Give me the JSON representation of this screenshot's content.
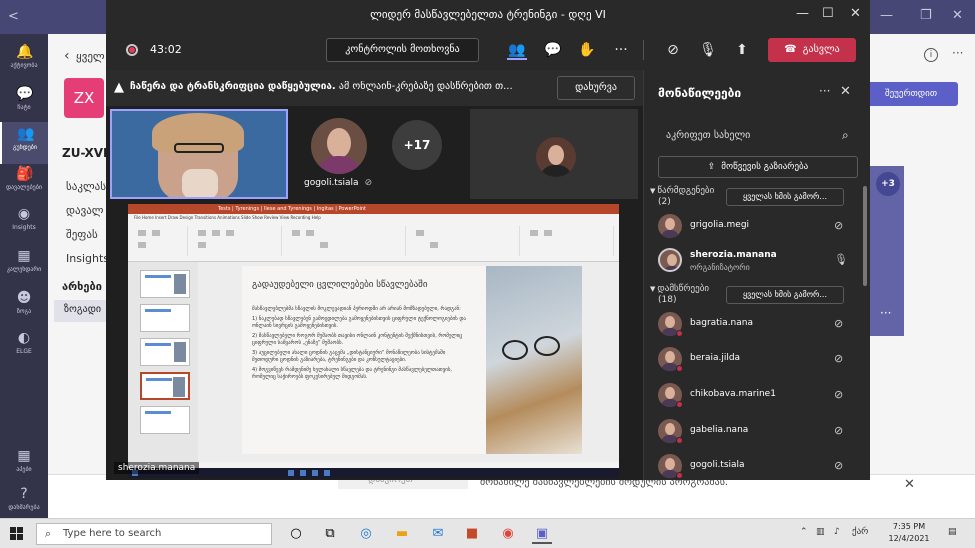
{
  "meeting": {
    "title": "ლიდერ მასწავლებელთა ტრენინგი - დღე VI",
    "timer": "43:02",
    "control_request": "კონტროლის მოთხოვნა",
    "leave": "გასვლა",
    "banner_bold": "ჩაწერა და ტრანსკრიფცია დაწყებულია.",
    "banner_text": "ამ ონლაინ-კრებაზე დასწრებით თ...",
    "banner_close": "დახურვა",
    "tile_name": "gogoli.tsiala",
    "overflow_count": "+17",
    "share_presenter": "sherozia.manana"
  },
  "slide": {
    "title": "გადაუდებელი ცვლილებები სწავლებაში",
    "app_title": "Tests | Tyrenings | Ilese and Tyrenings | Ingitas | PowerPoint",
    "tabs": "File  Home  Insert  Draw  Design  Transitions  Animations  Slide Show  Review  View  Recording  Help",
    "paragraphs": [
      "მასწავლებლებმა სწავლის მოკლევადიან პერიოდში არ არიან მომზადებული, რადგან:",
      "1) ნაკლებად სწავლებენ გამოცდილება გამოყენებისთვის ციფრული ტექნოლოგიების და ონლაინ სივრცის გამოყენებისთვის.",
      "2) მასწავლებელი როგორ მუშაობს თავისი ონლაინ კონტენტის შექმნისთვის, რომელიც ციფრული სამყაროს „ენაზე“ მუშაობს.",
      "3) აუცილებელი ახალი ცოდნის გაცემა „დისტანციური“ მონაწილეობა სისტემაში მეთოდური ცოდნის გაზიარება, ტრენინგები და კონსულტაციები.",
      "4) მოგვიწევს რამდენიმე ხელახალი სწავლება და ტრენინგი მასწავლებელთათვის, რომელიც საჭიროებს ფოკუსირებულ მიდგომას."
    ]
  },
  "toolbar_icons": [
    "people-icon",
    "chat-icon",
    "reactions-icon",
    "more-icon",
    "camera-off-icon",
    "mic-off-icon",
    "share-tray-icon"
  ],
  "participants": {
    "header": "მონაწილეები",
    "search_placeholder": "აკრიფეთ სახელი",
    "share_invite": "მოწვევის გაზიარება",
    "presenters_label": "წარმდგენები",
    "presenters_count": "(2)",
    "attendees_label": "დამსწრეები",
    "attendees_count": "(18)",
    "mute_all": "ყველას ხმის გამორ...",
    "presenters": [
      {
        "name": "grigolia.megi",
        "role": "",
        "mic": "mic-off"
      },
      {
        "name": "sherozia.manana",
        "role": "ორგანიზატორი",
        "mic": "mic-on"
      }
    ],
    "attendees": [
      {
        "name": "bagratia.nana"
      },
      {
        "name": "beraia.jilda"
      },
      {
        "name": "chikobava.marine1"
      },
      {
        "name": "gabelia.nana"
      },
      {
        "name": "gogoli.tsiala"
      }
    ]
  },
  "background": {
    "team_avatar": "ZX",
    "team_top": "ყველ",
    "team_title": "ZU-XVI",
    "links": [
      "საკლასო",
      "დავალ",
      "შეფას",
      "Insights"
    ],
    "section": "არხები",
    "channel": "ზოგადი",
    "join_button": "შეუერთდით",
    "card_count": "+3",
    "bottom_text": "მონაწილე მასწავლებლების მოდულის პროგრამას.",
    "ghost_text": "დააჭირეთ"
  },
  "rail": [
    {
      "icon": "bell-icon",
      "glyph": "🔔",
      "label": "აქტივობა"
    },
    {
      "icon": "chat-icon",
      "glyph": "💬",
      "label": "ჩატი"
    },
    {
      "icon": "teams-icon",
      "glyph": "👥",
      "label": "გუნდები"
    },
    {
      "icon": "assignments-icon",
      "glyph": "🎒",
      "label": "დავალებები"
    },
    {
      "icon": "insights-icon",
      "glyph": "◉",
      "label": "Insights"
    },
    {
      "icon": "calendar-icon",
      "glyph": "▦",
      "label": "კალენდარი"
    },
    {
      "icon": "bots-icon",
      "glyph": "☻",
      "label": "ზოგა"
    },
    {
      "icon": "elge-icon",
      "glyph": "◐",
      "label": "ELGE"
    },
    {
      "icon": "apps-icon",
      "glyph": "▦",
      "label": "აპები"
    },
    {
      "icon": "help-icon",
      "glyph": "?",
      "label": "დახმარება"
    }
  ],
  "taskbar": {
    "search_placeholder": "Type here to search",
    "lang": "ქარ",
    "time": "7:35 PM",
    "date": "12/4/2021"
  },
  "colors": {
    "teams_purple": "#464775",
    "leave_red": "#c4314b",
    "accent": "#9ea2ff"
  }
}
